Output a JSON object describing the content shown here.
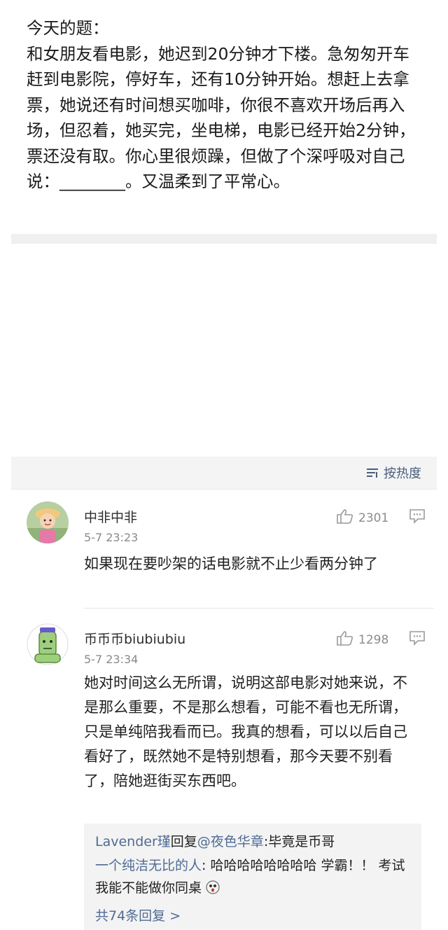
{
  "post": {
    "text": "今天的题：\n和女朋友看电影，她迟到20分钟才下楼。急匆匆开车赶到电影院，停好车，还有10分钟开始。想赶上去拿票，她说还有时间想买咖啡，你很不喜欢开场后再入场，但忍着，她买完，坐电梯，电影已经开始2分钟，票还没有取。你心里很烦躁，但做了个深呼吸对自己说：________。又温柔到了平常心。"
  },
  "sort": {
    "label": "按热度",
    "icon": "sort-lines-icon"
  },
  "comments": [
    {
      "name": "中非中非",
      "time": "5-7 23:23",
      "likes": "2301",
      "body": "如果现在要吵架的话电影就不止少看两分钟了"
    },
    {
      "name": "币币币biubiubiu",
      "time": "5-7 23:34",
      "likes": "1298",
      "body": "她对时间这么无所谓，说明这部电影对她来说，不是那么重要，不是那么想看，可能不看也无所谓，只是单纯陪我看而已。我真的想看，可以以后自己看好了，既然她不是特别想看，那今天要不别看了，陪她逛街买东西吧。"
    }
  ],
  "replies": [
    {
      "user": "Lavender瑾",
      "mid": "回复",
      "mention": "@夜色华章",
      "text": ":毕竟是币哥"
    },
    {
      "user": "一个纯洁无比的人",
      "text": ": 哈哈哈哈哈哈哈哈 学霸！！ 考试我能不能做你同桌",
      "emoji": "scared-face-emoji"
    }
  ],
  "reply_more": "共74条回复 >",
  "colors": {
    "link": "#4f6b95",
    "muted": "#8c8c8c"
  }
}
